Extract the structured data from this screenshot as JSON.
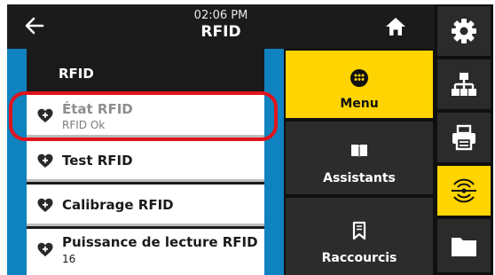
{
  "header": {
    "time": "02:06 PM",
    "title": "RFID"
  },
  "list": {
    "heading": "RFID",
    "items": [
      {
        "label": "État RFID",
        "value": "RFID Ok",
        "dimmed": true
      },
      {
        "label": "Test RFID"
      },
      {
        "label": "Calibrage RFID"
      },
      {
        "label": "Puissance de lecture RFID",
        "value": "16"
      }
    ]
  },
  "menu": {
    "items": [
      {
        "label": "Menu",
        "icon": "menu-grid-icon",
        "active": true
      },
      {
        "label": "Assistants",
        "icon": "book-icon"
      },
      {
        "label": "Raccourcis",
        "icon": "bookmark-icon"
      }
    ]
  },
  "iconbar": [
    {
      "icon": "gear-icon"
    },
    {
      "icon": "network-icon"
    },
    {
      "icon": "printer-icon"
    },
    {
      "icon": "rfid-icon",
      "active": true
    },
    {
      "icon": "folder-icon"
    }
  ],
  "colors": {
    "accent": "#ffd400",
    "stripe": "#0f82c0",
    "highlight": "#e0141c"
  }
}
